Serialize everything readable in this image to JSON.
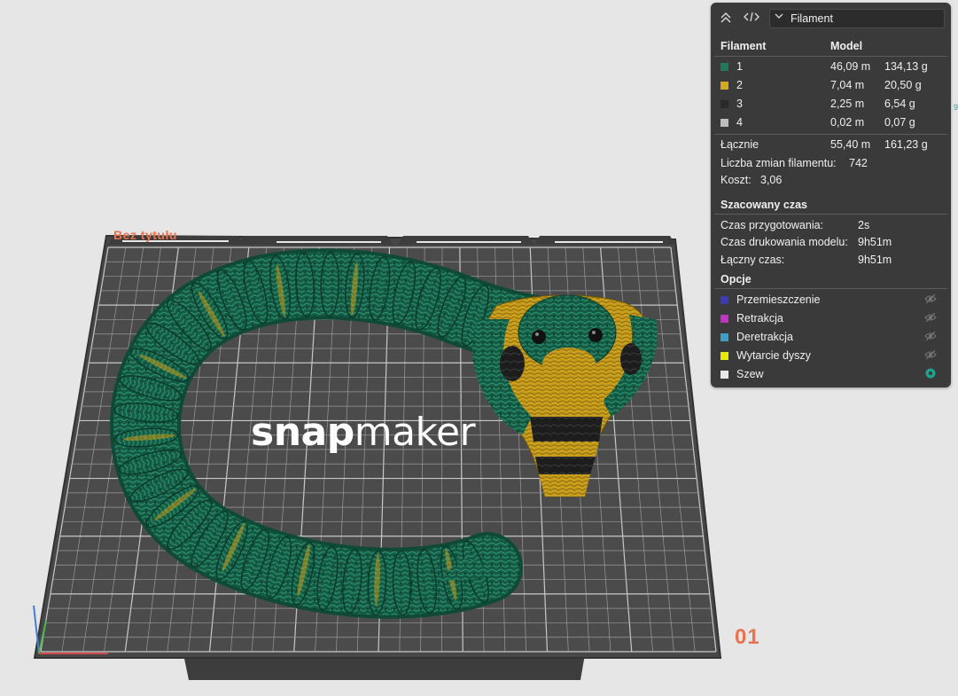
{
  "plate": {
    "name": "Bez tytułu",
    "number": "01",
    "brand_bold": "snap",
    "brand_light": "maker"
  },
  "edge_mark": "9",
  "panel": {
    "dropdown_value": "Filament",
    "headers": {
      "filament": "Filament",
      "model": "Model"
    },
    "filaments": [
      {
        "index": "1",
        "color": "#1f7a5a",
        "length": "46,09 m",
        "weight": "134,13 g"
      },
      {
        "index": "2",
        "color": "#d4a820",
        "length": "7,04 m",
        "weight": "20,50 g"
      },
      {
        "index": "3",
        "color": "#2a2a2a",
        "length": "2,25 m",
        "weight": "6,54 g"
      },
      {
        "index": "4",
        "color": "#bdbdbd",
        "length": "0,02 m",
        "weight": "0,07 g"
      }
    ],
    "total": {
      "label": "Łącznie",
      "length": "55,40 m",
      "weight": "161,23 g"
    },
    "changes": {
      "label": "Liczba zmian filamentu:",
      "value": "742"
    },
    "cost": {
      "label": "Koszt:",
      "value": "3,06"
    },
    "time_section": "Szacowany czas",
    "times": [
      {
        "label": "Czas przygotowania:",
        "value": "2s"
      },
      {
        "label": "Czas drukowania modelu:",
        "value": "9h51m"
      },
      {
        "label": "Łączny czas:",
        "value": "9h51m"
      }
    ],
    "options_section": "Opcje",
    "options": [
      {
        "label": "Przemieszczenie",
        "color": "#3b3bb5",
        "visible": false
      },
      {
        "label": "Retrakcja",
        "color": "#c035c0",
        "visible": false
      },
      {
        "label": "Deretrakcja",
        "color": "#3aa0c8",
        "visible": false
      },
      {
        "label": "Wytarcie dyszy",
        "color": "#e8e800",
        "visible": false
      },
      {
        "label": "Szew",
        "color": "#e8e8e8",
        "visible": true
      }
    ],
    "icons": [
      "collapse-icon",
      "code-icon",
      "chevron-down-icon",
      "eye-hidden-icon",
      "eye-visible-icon"
    ]
  }
}
